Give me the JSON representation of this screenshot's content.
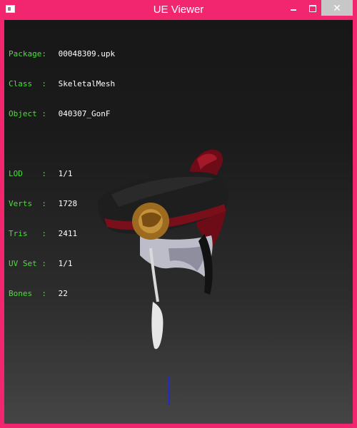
{
  "window": {
    "title": "UE Viewer",
    "accent": "#f2266f"
  },
  "controls": {
    "minimize_icon": "minimize-icon",
    "maximize_icon": "maximize-icon",
    "close_label": "✕"
  },
  "info": {
    "package_label": "Package:",
    "package_value": "00048309.upk",
    "class_label": "Class  :",
    "class_value": "SkeletalMesh",
    "object_label": "Object :",
    "object_value": "040307_GonF",
    "lod_label": "LOD    :",
    "lod_value": "1/1",
    "verts_label": "Verts  :",
    "verts_value": "1728",
    "tris_label": "Tris   :",
    "tris_value": "2411",
    "uvset_label": "UV Set :",
    "uvset_value": "1/1",
    "bones_label": "Bones  :",
    "bones_value": "22",
    "label_color": "#4cde3c"
  },
  "viewport": {
    "model_icon": "hat-model",
    "axis_color": "#1f2bd1"
  }
}
